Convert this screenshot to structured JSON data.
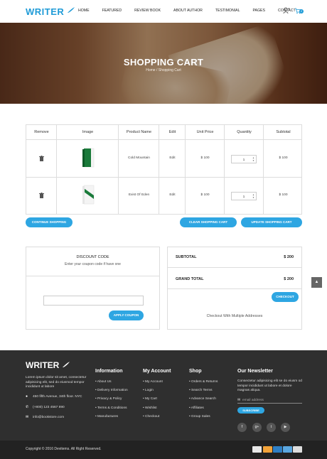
{
  "header": {
    "logo": "WRITER",
    "nav": [
      "HOME",
      "FEATURED",
      "REVIEW BOOK",
      "ABOUT AUTHOR",
      "TESTIMONIAL",
      "PAGES",
      "CONTACT"
    ],
    "cart_count": "2",
    "icons": [
      "user-icon",
      "cart-icon"
    ],
    "accent": "#1f9bd7"
  },
  "banner": {
    "title": "SHOPPING CART",
    "breadcrumb": "Home / Shopping Cart"
  },
  "cart": {
    "headers": [
      "Remove",
      "Image",
      "Product Name",
      "Edit",
      "Unit Price",
      "Quantity",
      "Subtotal"
    ],
    "rows": [
      {
        "name": "Cold Mountain",
        "edit": "Edit",
        "price": "$ 100",
        "qty": "1",
        "subtotal": "$ 100"
      },
      {
        "name": "Exist Of Eden",
        "edit": "Edit",
        "price": "$ 100",
        "qty": "1",
        "subtotal": "$ 100"
      }
    ],
    "continue_label": "CONTINUE SHOPPING",
    "clear_label": "CLEAR SHOPPING CART",
    "update_label": "UPDATE SHOPPING CART"
  },
  "discount": {
    "title": "DISCOUNT CODE",
    "subtitle": "Enter your coupon code if have one",
    "coupon_value": "",
    "apply_label": "APPLY COUPON"
  },
  "totals": {
    "subtotal_label": "SUBTOTAL",
    "subtotal_value": "$ 200",
    "grand_label": "GRAND TOTAL",
    "grand_value": "$ 200",
    "checkout_label": "CHECKOUT",
    "multi_label": "Checkout With Multiple Addresses"
  },
  "footer": {
    "logo": "WRITER",
    "about": "Lorem ipsum dolor sit amet, consectetur adipisicing elit, sed do eiusmod tempor incididunt ut labore",
    "address": "450 fifth Avenue, 34th floor. NYC",
    "phone": "(+800) 123 4567 890",
    "email": "info@bookstore.com",
    "columns": [
      {
        "title": "Information",
        "links": [
          "About Us",
          "Delivery Information",
          "Privacy & Policy",
          "Terms & Conditions",
          "Manufactures"
        ]
      },
      {
        "title": "My Account",
        "links": [
          "My Account",
          "Login",
          "My Cart",
          "Wishlist",
          "Checkout"
        ]
      },
      {
        "title": "Shop",
        "links": [
          "Orders & Returns",
          "Search Terms",
          "Advance Search",
          "Affiliates",
          "Group Sales"
        ]
      }
    ],
    "newsletter": {
      "title": "Our Newsletter",
      "text": "Consectetur adipisicing elit se do eiusm od tempor incididunt ut labore et dolore magnas aliqua.",
      "placeholder": "email address",
      "subscribe_label": "SUBSCRIBE"
    },
    "social_icons": [
      "facebook-icon",
      "google-plus-icon",
      "twitter-icon",
      "youtube-icon"
    ],
    "copyright_text": "Copyright © 2016 Devitems. All Right Reserved.",
    "payment_icons": [
      "visa-icon",
      "mastercard-icon",
      "amex-icon",
      "maestro-icon",
      "discover-icon"
    ]
  }
}
